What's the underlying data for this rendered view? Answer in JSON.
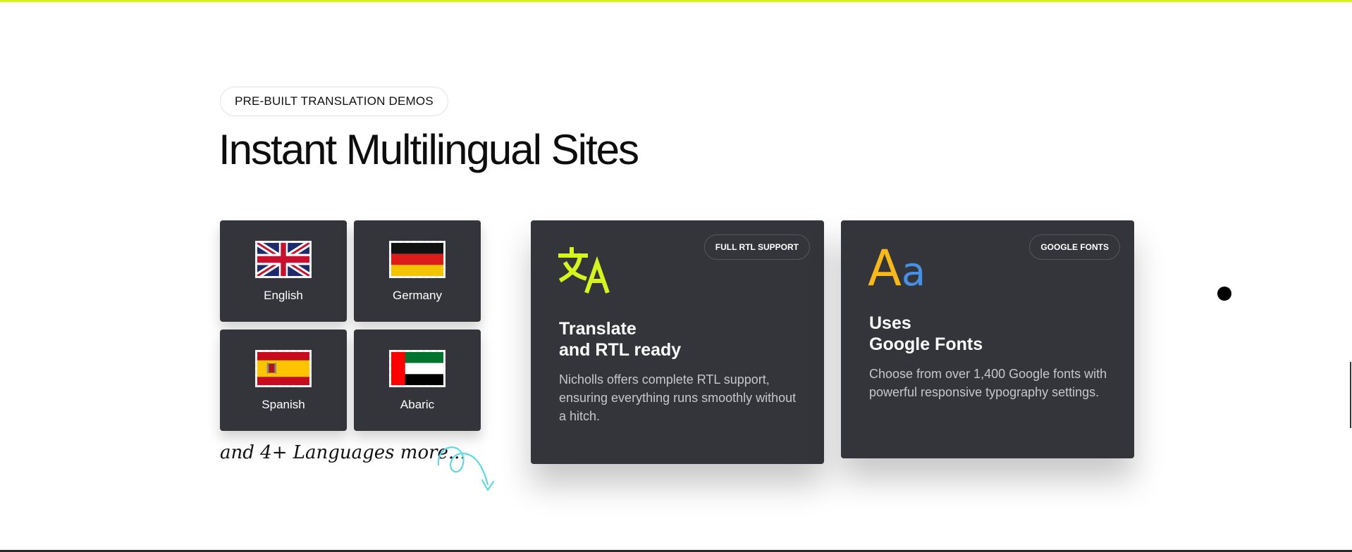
{
  "section": {
    "eyebrow": "PRE-BUILT TRANSLATION DEMOS",
    "title": "Instant Multilingual Sites"
  },
  "languages": [
    {
      "label": "English",
      "flag": "uk-flag-icon"
    },
    {
      "label": "Germany",
      "flag": "germany-flag-icon"
    },
    {
      "label": "Spanish",
      "flag": "spain-flag-icon"
    },
    {
      "label": "Abaric",
      "flag": "uae-flag-icon"
    }
  ],
  "more_languages": "and 4+ Languages more...",
  "features": [
    {
      "badge": "FULL RTL SUPPORT",
      "icon": "translate-icon",
      "title_line1": "Translate",
      "title_line2": "and RTL ready",
      "description": "Nicholls offers complete RTL support, ensuring everything runs smoothly without a hitch."
    },
    {
      "badge": "GOOGLE FONTS",
      "icon": "font-aa-icon",
      "title_line1": "Uses",
      "title_line2": "Google Fonts",
      "description": "Choose from over 1,400 Google fonts with powerful responsive typography settings."
    }
  ],
  "colors": {
    "accent": "#d6f51f",
    "card_bg": "#33353b",
    "swirl": "#5fd9e4",
    "font_icon_a_upper": "#f7b81c",
    "font_icon_a_lower": "#4a90e2"
  }
}
